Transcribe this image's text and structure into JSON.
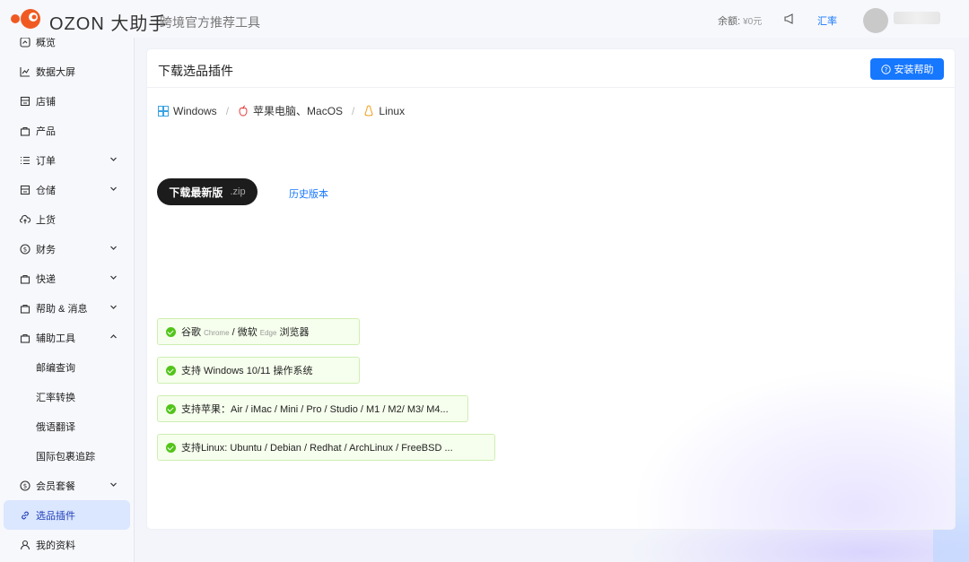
{
  "header": {
    "brand": "OZON 大助手",
    "subtitle": "跨境官方推荐工具",
    "balance_label": "余额:",
    "balance_value": "¥0元",
    "rate_link": "汇率",
    "accent_color": "#1677ff"
  },
  "sidebar": {
    "items": [
      {
        "label": "概览",
        "icon": "gauge-icon"
      },
      {
        "label": "数据大屏",
        "icon": "line-chart-icon"
      },
      {
        "label": "店铺",
        "icon": "store-icon"
      },
      {
        "label": "产品",
        "icon": "bag-icon"
      },
      {
        "label": "订单",
        "icon": "list-icon"
      },
      {
        "label": "仓储",
        "icon": "warehouse-icon"
      },
      {
        "label": "上货",
        "icon": "cloud-upload-icon"
      },
      {
        "label": "财务",
        "icon": "dollar-icon"
      },
      {
        "label": "快递",
        "icon": "bag-icon"
      },
      {
        "label": "帮助 & 消息",
        "icon": "bag-icon"
      },
      {
        "label": "辅助工具",
        "icon": "bag-icon"
      },
      {
        "label": "邮编查询"
      },
      {
        "label": "汇率转换"
      },
      {
        "label": "俄语翻译"
      },
      {
        "label": "国际包裹追踪"
      },
      {
        "label": "会员套餐",
        "icon": "dollar-icon"
      },
      {
        "label": "选品插件",
        "icon": "link-icon"
      },
      {
        "label": "我的资料",
        "icon": "user-icon"
      }
    ]
  },
  "main": {
    "title": "下载选品插件",
    "help_button": "安装帮助",
    "os_tabs": [
      "Windows",
      "苹果电脑、MacOS",
      "Linux"
    ],
    "download_button": "下载最新版",
    "download_ext": ".zip",
    "history_link": "历史版本",
    "features": {
      "f1_a": "谷歌",
      "f1_b": "Chrome",
      "f1_c": "/ 微软",
      "f1_d": "Edge",
      "f1_e": "浏览器",
      "f2": "支持 Windows 10/11 操作系统",
      "f3": "支持苹果：Air / iMac / Mini / Pro / Studio / M1 / M2/ M3/ M4...",
      "f4": "支持Linux: Ubuntu / Debian / Redhat / ArchLinux / FreeBSD ..."
    }
  }
}
